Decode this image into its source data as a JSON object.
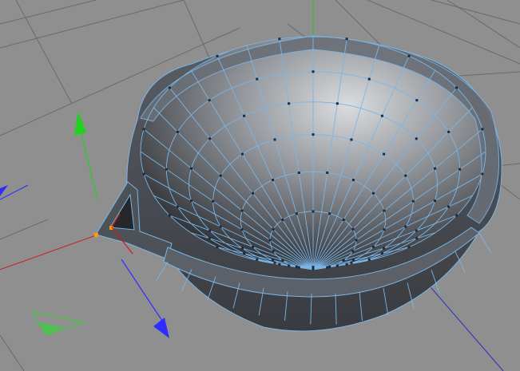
{
  "viewport": {
    "background": "#8f8f8f",
    "grid_color": "#6a6a6a"
  },
  "axes": {
    "x_color": "#d01818",
    "y_color": "#22c322",
    "z_color": "#2c2cc8"
  },
  "gizmo": {
    "x_color": "#d83030",
    "y_color": "#1ed21e",
    "z_color": "#2d2dff",
    "plane_color": "#44c844"
  },
  "mesh": {
    "name": "bowl-with-spout",
    "wire_color": "#7ab6e8",
    "point_color": "#1e2a3a",
    "selected_point_color": "#ff9a00",
    "shell_outer": "#3c3e44",
    "shell_rim_top": "#6e737a",
    "inner_light": "#d8dadd",
    "inner_dark": "#2a2b2e"
  },
  "icons": {
    "move_tool": "move-gizmo-icon",
    "world_axis": "world-axis-icon"
  }
}
